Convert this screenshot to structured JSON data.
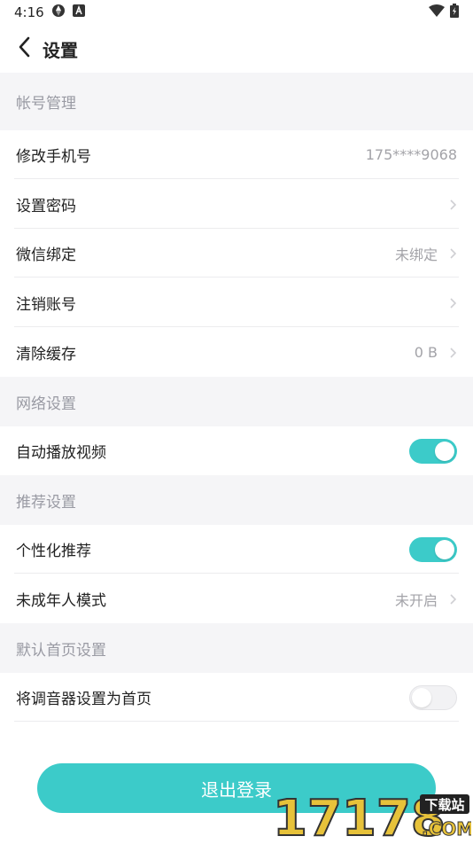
{
  "status_bar": {
    "time": "4:16"
  },
  "nav": {
    "title": "设置"
  },
  "sections": {
    "account": "帐号管理",
    "network": "网络设置",
    "recommend": "推荐设置",
    "homepage": "默认首页设置"
  },
  "rows": {
    "change_phone": {
      "label": "修改手机号",
      "value": "175****9068"
    },
    "set_password": {
      "label": "设置密码"
    },
    "wechat": {
      "label": "微信绑定",
      "value": "未绑定"
    },
    "cancel_account": {
      "label": "注销账号"
    },
    "clear_cache": {
      "label": "清除缓存",
      "value": "0 B"
    },
    "autoplay": {
      "label": "自动播放视频",
      "enabled": true
    },
    "personalized": {
      "label": "个性化推荐",
      "enabled": true
    },
    "minor_mode": {
      "label": "未成年人模式",
      "value": "未开启"
    },
    "tuner_home": {
      "label": "将调音器设置为首页",
      "enabled": false
    }
  },
  "logout": {
    "label": "退出登录"
  },
  "watermark": {
    "text": "17178",
    "badge": "下载站",
    "suffix": ".COM"
  },
  "colors": {
    "accent": "#3ccbc9",
    "section_bg": "#f5f5f7",
    "muted": "#a3a3a8"
  }
}
